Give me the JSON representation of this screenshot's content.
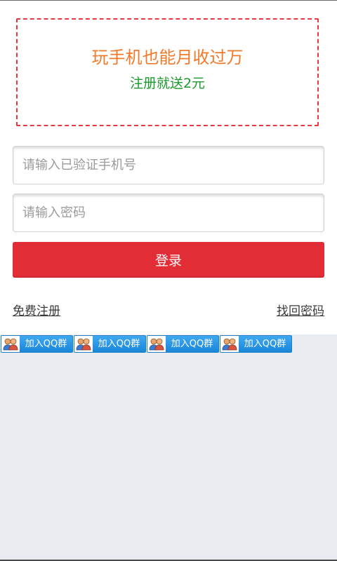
{
  "banner": {
    "headline": "玩手机也能月收过万",
    "subline": "注册就送2元"
  },
  "form": {
    "phone_placeholder": "请输入已验证手机号",
    "password_placeholder": "请输入密码",
    "login_label": "登录"
  },
  "links": {
    "register": "免费注册",
    "recover": "找回密码"
  },
  "qq_buttons": [
    {
      "label": "加入QQ群",
      "icon": "qq-group-icon"
    },
    {
      "label": "加入QQ群",
      "icon": "qq-group-icon"
    },
    {
      "label": "加入QQ群",
      "icon": "qq-group-icon"
    },
    {
      "label": "加入QQ群",
      "icon": "qq-group-icon"
    }
  ],
  "colors": {
    "banner_border": "#e6393f",
    "headline": "#f07a2a",
    "subline": "#1a9a2a",
    "login_button": "#e22c36",
    "qq_button": "#1a86d8",
    "background_gray": "#e8ebef"
  }
}
